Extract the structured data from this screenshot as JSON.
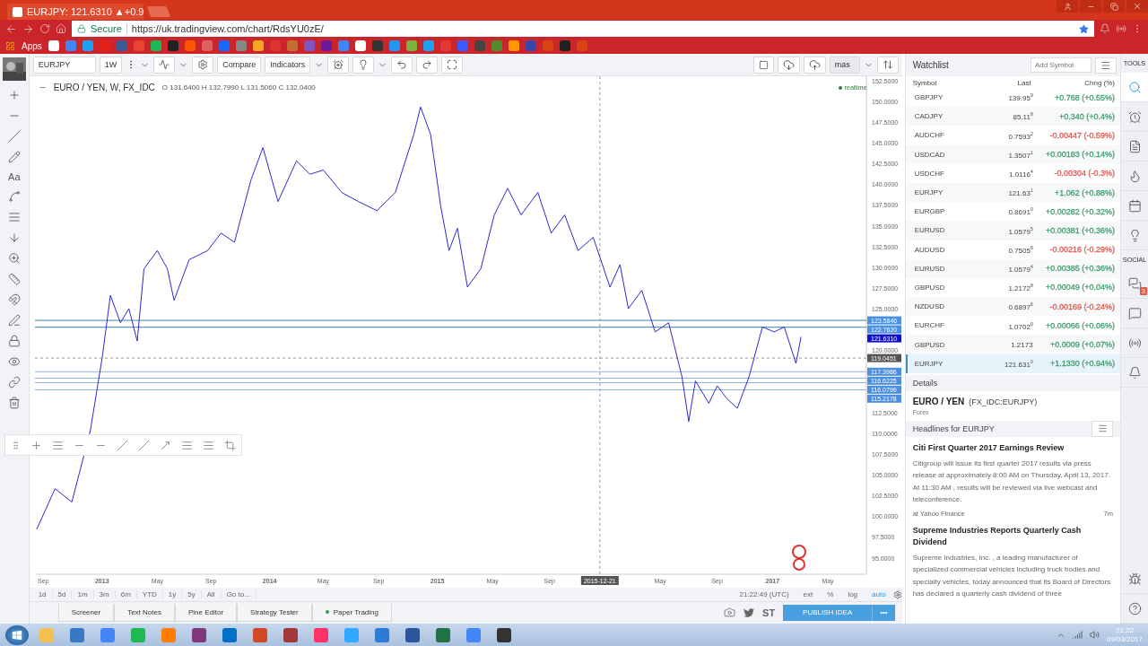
{
  "browser": {
    "tab_title": "EURJPY: 121.6310 ▲+0.9",
    "secure": "Secure",
    "url": "https://uk.tradingview.com/chart/RdsYU0zE/",
    "bookmarks_label": "Apps"
  },
  "toolbar": {
    "symbol": "EURJPY",
    "interval": "1W",
    "compare": "Compare",
    "indicators": "Indicators",
    "layout": "mas"
  },
  "left_tools": {
    "text_tool": "Aa"
  },
  "chart": {
    "title": "EURO / YEN, W, FX_IDC",
    "ohlc": "O 131.6400 H 132.7990 L 131.5060 C 132.0400",
    "status": "realtime",
    "chart_data": {
      "type": "line",
      "x": [
        2012.61,
        2012.72,
        2012.82,
        2012.93,
        2013.0,
        2013.05,
        2013.11,
        2013.16,
        2013.21,
        2013.25,
        2013.33,
        2013.39,
        2013.43,
        2013.52,
        2013.63,
        2013.71,
        2013.79,
        2013.89,
        2013.96,
        2014.05,
        2014.16,
        2014.24,
        2014.32,
        2014.43,
        2014.53,
        2014.64,
        2014.75,
        2014.86,
        2014.9,
        2014.96,
        2015.02,
        2015.07,
        2015.12,
        2015.18,
        2015.26,
        2015.34,
        2015.42,
        2015.5,
        2015.6,
        2015.68,
        2015.76,
        2015.84,
        2015.93,
        2016.03,
        2016.09,
        2016.14,
        2016.22,
        2016.3,
        2016.38,
        2016.46,
        2016.5,
        2016.54,
        2016.62,
        2016.67,
        2016.73,
        2016.79,
        2016.86,
        2016.94,
        2017.01,
        2017.07,
        2017.14,
        2017.17
      ],
      "series": [
        {
          "color": "#2a2ad0",
          "values": [
            98.4,
            103.3,
            101.7,
            110.3,
            119,
            126.6,
            123.3,
            125,
            121.1,
            129.8,
            132,
            129.8,
            126,
            130.9,
            132,
            134.1,
            133,
            140.6,
            144.4,
            137.9,
            142.8,
            141.2,
            141.7,
            139,
            137.9,
            136.8,
            139,
            146,
            149.3,
            146,
            137.4,
            132,
            134.7,
            127.6,
            129.8,
            136.3,
            139.5,
            136.3,
            139,
            134.1,
            136.3,
            132,
            133.6,
            127.6,
            130.3,
            125,
            127.2,
            122.2,
            123.3,
            116.8,
            111.4,
            116.3,
            113.6,
            115.7,
            114.1,
            113,
            116.8,
            122.8,
            122.2,
            122.8,
            118.4,
            121.6
          ]
        }
      ],
      "xlim": [
        2012.6,
        2017.56
      ],
      "ylim": [
        93,
        153
      ],
      "xticks": [
        {
          "value": 2012.65,
          "label": "Sep"
        },
        {
          "value": 2013.0,
          "label": "2013"
        },
        {
          "value": 2013.33,
          "label": "May"
        },
        {
          "value": 2013.65,
          "label": "Sep"
        },
        {
          "value": 2014.0,
          "label": "2014"
        },
        {
          "value": 2014.32,
          "label": "May"
        },
        {
          "value": 2014.65,
          "label": "Sep"
        },
        {
          "value": 2015.0,
          "label": "2015"
        },
        {
          "value": 2015.33,
          "label": "May"
        },
        {
          "value": 2015.67,
          "label": "Sep"
        },
        {
          "value": 2016.33,
          "label": "May"
        },
        {
          "value": 2016.67,
          "label": "Sep"
        },
        {
          "value": 2017.0,
          "label": "2017"
        },
        {
          "value": 2017.33,
          "label": "May"
        }
      ],
      "yticks": [
        {
          "value": 152.5,
          "label": "152.5000"
        },
        {
          "value": 150,
          "label": "150.0000"
        },
        {
          "value": 147.5,
          "label": "147.5000"
        },
        {
          "value": 145,
          "label": "145.0000"
        },
        {
          "value": 142.5,
          "label": "142.5000"
        },
        {
          "value": 140,
          "label": "140.0000"
        },
        {
          "value": 137.5,
          "label": "137.5000"
        },
        {
          "value": 135,
          "label": "135.0000"
        },
        {
          "value": 132.5,
          "label": "132.5000"
        },
        {
          "value": 130,
          "label": "130.0000"
        },
        {
          "value": 127.5,
          "label": "127.5000"
        },
        {
          "value": 125,
          "label": "125.0000"
        },
        {
          "value": 120,
          "label": "120.0000"
        },
        {
          "value": 112.5,
          "label": "112.5000"
        },
        {
          "value": 110,
          "label": "110.0000"
        },
        {
          "value": 107.5,
          "label": "107.5000"
        },
        {
          "value": 105,
          "label": "105.0000"
        },
        {
          "value": 102.5,
          "label": "102.5000"
        },
        {
          "value": 100,
          "label": "100.0000"
        },
        {
          "value": 97.5,
          "label": "97.5000"
        },
        {
          "value": 95,
          "label": "95.0000"
        }
      ],
      "ref_lines": [
        {
          "axis": "y",
          "value": 123.5846,
          "label": "123.5846",
          "color": "#3d7ea6"
        },
        {
          "axis": "y",
          "value": 122.762,
          "label": "122.7620",
          "color": "#3d7ea6"
        },
        {
          "axis": "y",
          "value": 119.0451,
          "label": "119.0451",
          "color": "#999999"
        },
        {
          "axis": "x",
          "value": 2015.97,
          "color": "#999999"
        },
        {
          "axis": "y",
          "value": 117.3986,
          "label": "117.3986",
          "color": "#8fb6e6"
        },
        {
          "axis": "y",
          "value": 116.6225,
          "label": "116.6225",
          "color": "#8fb6e6"
        },
        {
          "axis": "y",
          "value": 116.0799,
          "label": "116.0799",
          "color": "#8fb6e6"
        },
        {
          "axis": "y",
          "value": 115.2178,
          "label": "115.2178",
          "color": "#8fb6e6"
        }
      ]
    },
    "last_price": "121.6310",
    "crosshair_date": "2015-12-21"
  },
  "time_ranges": [
    "1d",
    "5d",
    "1m",
    "3m",
    "6m",
    "YTD",
    "1y",
    "5y",
    "All",
    "Go to..."
  ],
  "time_bar": {
    "clock": "21:22:49 (UTC)",
    "options": [
      {
        "label": "ext",
        "selected": false
      },
      {
        "label": "%",
        "selected": false
      },
      {
        "label": "log",
        "selected": false
      },
      {
        "label": "auto",
        "selected": true
      }
    ]
  },
  "bottom_tabs": [
    {
      "label": "Screener",
      "dot": false
    },
    {
      "label": "Text Notes",
      "dot": false
    },
    {
      "label": "Pine Editor",
      "dot": false
    },
    {
      "label": "Strategy Tester",
      "dot": false
    },
    {
      "label": "Paper Trading",
      "dot": true
    }
  ],
  "publish": {
    "st": "ST",
    "button": "PUBLISH IDEA",
    "more": "•••"
  },
  "watchlist": {
    "title": "Watchlist",
    "search_placeholder": "Add Symbol",
    "columns": [
      "Symbol",
      "Last",
      "Chng (%)"
    ],
    "rows": [
      {
        "symbol": "GBPJPY",
        "last": "139.95$^{9}$",
        "change": "+0.768 (+0.55%)",
        "color": "#3f9e6e",
        "selected": false
      },
      {
        "symbol": "CADJPY",
        "last": "85.11$^{8}$",
        "change": "+0.340 (+0.4%)",
        "color": "#3f9e6e",
        "selected": false
      },
      {
        "symbol": "AUDCHF",
        "last": "0.7593$^{2}$",
        "change": "-0.00447 (-0.59%)",
        "color": "#e0574f",
        "selected": false
      },
      {
        "symbol": "USDCAD",
        "last": "1.3507$^{1}$",
        "change": "+0.00183 (+0.14%)",
        "color": "#3f9e6e",
        "selected": false
      },
      {
        "symbol": "USDCHF",
        "last": "1.0116$^{4}$",
        "change": "-0.00304 (-0.3%)",
        "color": "#e0574f",
        "selected": false
      },
      {
        "symbol": "EURJPY",
        "last": "121.63$^{1}$",
        "change": "+1.062 (+0.88%)",
        "color": "#3f9e6e",
        "selected": false
      },
      {
        "symbol": "EURGBP",
        "last": "0.8691$^{0}$",
        "change": "+0.00282 (+0.32%)",
        "color": "#3f9e6e",
        "selected": false
      },
      {
        "symbol": "EURUSD",
        "last": "1.0579$^{5}$",
        "change": "+0.00381 (+0.36%)",
        "color": "#3f9e6e",
        "selected": false
      },
      {
        "symbol": "AUDUSD",
        "last": "0.7505$^{8}$",
        "change": "-0.00216 (-0.29%)",
        "color": "#e0574f",
        "selected": false
      },
      {
        "symbol": "EURUSD",
        "last": "1.0579$^{4}$",
        "change": "+0.00385 (+0.36%)",
        "color": "#3f9e6e",
        "selected": false
      },
      {
        "symbol": "GBPUSD",
        "last": "1.2172$^{8}$",
        "change": "+0.00049 (+0.04%)",
        "color": "#3f9e6e",
        "selected": false
      },
      {
        "symbol": "NZDUSD",
        "last": "0.6897$^{6}$",
        "change": "-0.00169 (-0.24%)",
        "color": "#e0574f",
        "selected": false
      },
      {
        "symbol": "EURCHF",
        "last": "1.0702$^{0}$",
        "change": "+0.00066 (+0.06%)",
        "color": "#3f9e6e",
        "selected": false
      },
      {
        "symbol": "GBPUSD",
        "last": "1.2173",
        "change": "+0.0009 (+0.07%)",
        "color": "#3f9e6e",
        "selected": false
      },
      {
        "symbol": "EURJPY",
        "last": "121.631$^{0}$",
        "change": "+1.1330 (+0.94%)",
        "color": "#3f9e6e",
        "selected": true
      }
    ]
  },
  "details": {
    "title": "Details",
    "name": "EURO / YEN",
    "ticker": "(FX_IDC:EURJPY)",
    "type": "Forex"
  },
  "headlines": {
    "title": "Headlines for EURJPY",
    "items": [
      {
        "title": "Citi First Quarter 2017 Earnings Review",
        "body": "Citigroup will issue its first quarter 2017 results via press release at approximately 8:00 AM on Thursday, April 13, 2017. At 11:30 AM , results will be reviewed via live webcast and teleconference.",
        "source": "at Yahoo Finance",
        "time": "7m"
      },
      {
        "title": "Supreme Industries Reports Quarterly Cash Dividend",
        "body": "Supreme Industries, Inc.  , a leading manufacturer of specialized commercial vehicles including truck bodies and specialty vehicles, today announced that its Board of Directors has declared a quarterly cash dividend of three"
      }
    ]
  },
  "tools_panel": {
    "tools_label": "TOOLS",
    "social_label": "SOCIAL",
    "badge": "3",
    "tabs": [
      {
        "selected": true
      },
      {
        "selected": false
      },
      {
        "selected": false
      },
      {
        "selected": false
      },
      {
        "selected": false
      },
      {
        "selected": false
      },
      {
        "selected": false
      },
      {
        "selected": false
      },
      {
        "selected": false
      },
      {
        "selected": false
      },
      {
        "selected": false
      },
      {
        "selected": false
      }
    ]
  },
  "taskbar": {
    "time": "21:22",
    "date": "09/03/2017"
  }
}
